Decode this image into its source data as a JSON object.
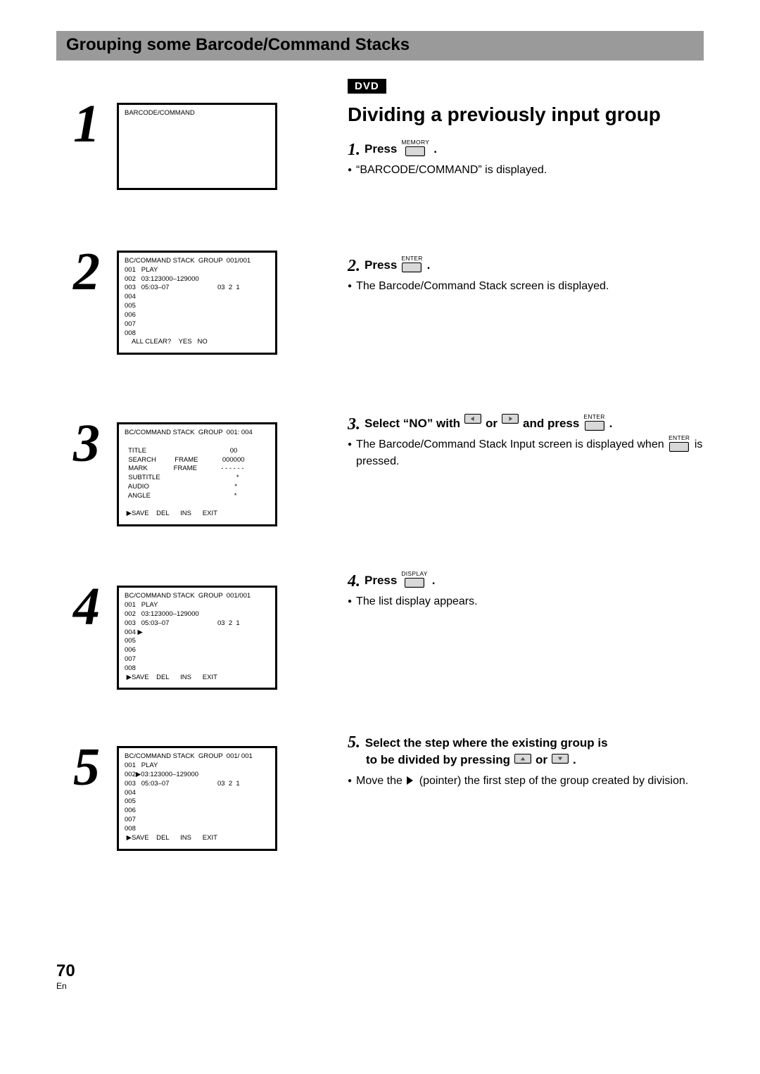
{
  "title_bar": "Grouping some Barcode/Command Stacks",
  "dvd_badge": "DVD",
  "section_heading": "Dividing a previously input group",
  "big_nums": [
    "1",
    "2",
    "3",
    "4",
    "5"
  ],
  "screens": {
    "s1_title": "BARCODE/COMMAND",
    "s2_header": "BC/COMMAND STACK  GROUP  001/001",
    "s2_lines": "001   PLAY\n002   03:123000–129000\n003   05:03–07                          03  2  1\n004\n005\n006\n007\n008",
    "s2_footer": "    ALL CLEAR?    YES   NO",
    "s3_header": "BC/COMMAND STACK  GROUP  001: 004",
    "s3_lines": "  TITLE                                             00\n  SEARCH          FRAME             000000\n  MARK              FRAME             - - - - - -\n  SUBTITLE                                         *\n  AUDIO                                              *\n  ANGLE                                             *",
    "s3_footer": " ▶SAVE    DEL      INS      EXIT",
    "s4_header": "BC/COMMAND STACK  GROUP  001/001",
    "s4_lines": "001   PLAY\n002   03:123000–129000\n003   05:03–07                          03  2  1\n004 ▶\n005\n006\n007\n008",
    "s4_footer": " ▶SAVE    DEL      INS      EXIT",
    "s5_header": "BC/COMMAND STACK  GROUP  001/ 001",
    "s5_lines": "001   PLAY\n002▶03:123000–129000\n003   05:03–07                          03  2  1\n004\n005\n006\n007\n008",
    "s5_footer": " ▶SAVE    DEL      INS      EXIT"
  },
  "right": {
    "r1": {
      "num": "1.",
      "press": "Press",
      "key": "MEMORY",
      "dot": ".",
      "bullet": "“BARCODE/COMMAND” is displayed."
    },
    "r2": {
      "num": "2.",
      "press": "Press",
      "key": "ENTER",
      "dot": ".",
      "bullet": "The Barcode/Command Stack screen is displayed."
    },
    "r3": {
      "num": "3.",
      "pre": "Select “NO” with",
      "mid": "or",
      "post": "and press",
      "key": "ENTER",
      "dot": ".",
      "bullet_a": "The Barcode/Command Stack Input screen is displayed when",
      "bullet_b": "is pressed."
    },
    "r4": {
      "num": "4.",
      "press": "Press",
      "key": "DISPLAY",
      "dot": ".",
      "bullet": "The list display appears."
    },
    "r5": {
      "num": "5.",
      "line1a": "Select the step where the existing group is",
      "line2a": "to be divided by pressing",
      "or": "or",
      "dot": ".",
      "bullet_a": "Move the",
      "bullet_b": "(pointer) the first step of the group created by division."
    }
  },
  "footer": {
    "page": "70",
    "lang": "En"
  }
}
